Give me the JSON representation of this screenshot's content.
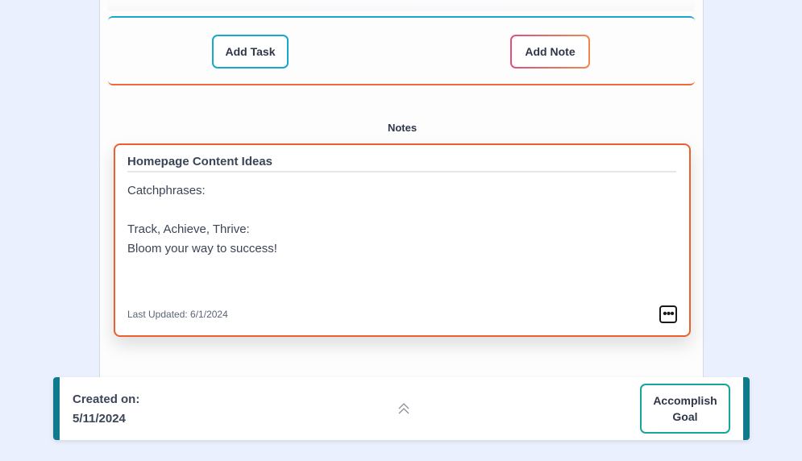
{
  "actions": {
    "add_task_label": "Add Task",
    "add_note_label": "Add Note"
  },
  "notes": {
    "heading": "Notes",
    "items": [
      {
        "title": "Homepage Content Ideas",
        "lines": [
          "Catchphrases:",
          "",
          "Track, Achieve, Thrive:",
          "Bloom your way to success!"
        ],
        "last_updated": "Last Updated: 6/1/2024",
        "menu_icon": "more-horizontal-icon"
      }
    ]
  },
  "footer": {
    "created_label": "Created on:",
    "created_date": "5/11/2024",
    "collapse_icon": "double-chevron-up-icon",
    "accomplish_label": "Accomplish\nGoal"
  },
  "colors": {
    "background": "#eaf0fd",
    "accent_blue": "#18a8cc",
    "accent_orange": "#ec5f2f",
    "accent_pink": "#e0507a",
    "teal": "#17a59a",
    "footer_edge": "#0f7a8c"
  }
}
